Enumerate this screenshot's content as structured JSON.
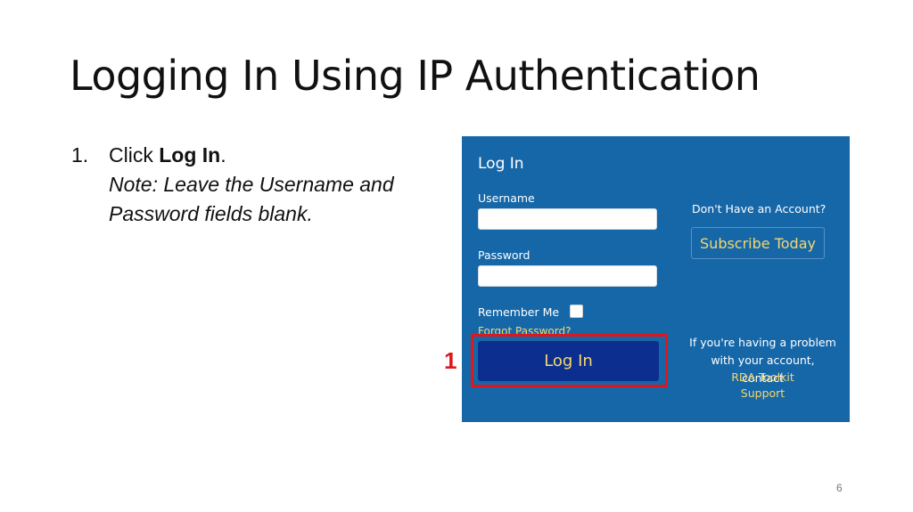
{
  "slide": {
    "title": "Logging In Using IP Authentication",
    "step_number": "1.",
    "step_prefix": "Click ",
    "step_bold": "Log In",
    "step_suffix": ".",
    "note_line1": "Note: Leave the Username and",
    "note_line2": "Password fields blank.",
    "callout_number": "1",
    "page_number": "6"
  },
  "login_panel": {
    "title": "Log In",
    "username_label": "Username",
    "username_value": "",
    "password_label": "Password",
    "password_value": "",
    "remember_label": "Remember Me",
    "remember_checked": false,
    "forgot_link": "Forgot Password?",
    "login_button": "Log In",
    "no_account_text": "Don't Have an Account?",
    "subscribe_button": "Subscribe Today",
    "help_line1": "If you're having a problem",
    "help_line2": "with your account, contact",
    "help_link_line1": "RDA Toolkit",
    "help_link_line2": "Support"
  },
  "colors": {
    "panel_bg": "#1667a8",
    "button_bg": "#0c2f8f",
    "link_yellow": "#f5d76e",
    "highlight_red": "#e0161b"
  }
}
